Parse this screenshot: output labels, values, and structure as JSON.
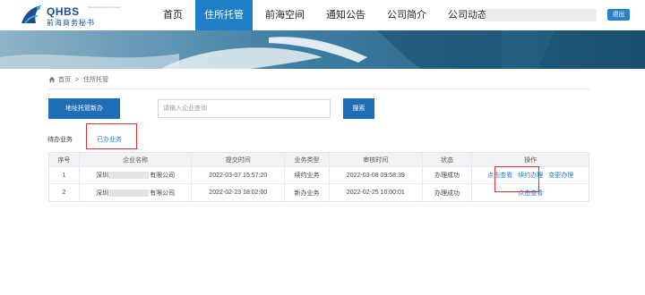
{
  "header": {
    "logo_title": "QHBS",
    "logo_subtitle": "前海商务秘书",
    "logo_tagline": "Qianhai Business Secretary",
    "nav": [
      "首页",
      "住所托管",
      "前海空间",
      "通知公告",
      "公司简介",
      "公司动态"
    ],
    "active_nav": "住所托管",
    "logout_label": "退出"
  },
  "breadcrumb": {
    "home": "首页",
    "separator": ">",
    "current": "住所托管"
  },
  "actions": {
    "new_button": "地址托管新办",
    "search_placeholder": "请输入企业查询",
    "search_button": "搜索"
  },
  "tabs": {
    "pending": "待办业务",
    "done": "已办业务"
  },
  "table": {
    "headers": [
      "序号",
      "企业名称",
      "提交时间",
      "业务类型",
      "审核时间",
      "状态",
      "操作"
    ],
    "rows": [
      {
        "index": "1",
        "company_prefix": "深圳",
        "company_suffix": "有限公司",
        "submitted": "2022-03-07 15:57:20",
        "type": "续约业务",
        "reviewed": "2022-03-08 09:58:39",
        "status": "办理成功",
        "actions": [
          "点击查看",
          "续约办理",
          "变更办理"
        ]
      },
      {
        "index": "2",
        "company_prefix": "深圳",
        "company_suffix": "有限公司",
        "submitted": "2022-02-23 18:02:00",
        "type": "新办业务",
        "reviewed": "2022-02-25 10:00:01",
        "status": "办理成功",
        "actions": [
          "点击查看"
        ]
      }
    ]
  },
  "colors": {
    "accent": "#1e7fc7",
    "button": "#1f6db4",
    "highlight": "#e03030"
  }
}
